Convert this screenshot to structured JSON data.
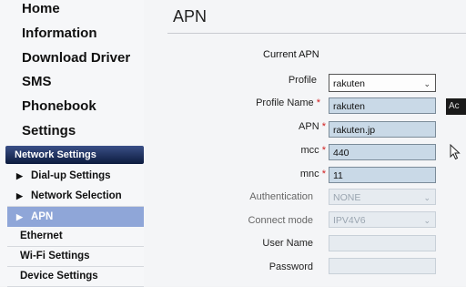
{
  "sidebar": {
    "items": [
      {
        "label": "Home"
      },
      {
        "label": "Information"
      },
      {
        "label": "Download Driver"
      },
      {
        "label": "SMS"
      },
      {
        "label": "Phonebook"
      },
      {
        "label": "Settings"
      }
    ],
    "network_settings": {
      "header": "Network Settings",
      "sub_items": [
        {
          "label": "Dial-up Settings"
        },
        {
          "label": "Network Selection"
        },
        {
          "label": "APN",
          "active": true
        }
      ]
    },
    "other_items": [
      {
        "label": "Ethernet"
      },
      {
        "label": "Wi-Fi Settings"
      },
      {
        "label": "Device Settings"
      }
    ]
  },
  "main": {
    "title": "APN",
    "current_apn_label": "Current APN",
    "fields": {
      "profile": {
        "label": "Profile",
        "value": "rakuten"
      },
      "profile_name": {
        "label": "Profile Name",
        "value": "rakuten",
        "required": "*"
      },
      "apn": {
        "label": "APN",
        "value": "rakuten.jp",
        "required": "*"
      },
      "mcc": {
        "label": "mcc",
        "value": "440",
        "required": "*"
      },
      "mnc": {
        "label": "mnc",
        "value": "11",
        "required": "*"
      },
      "authentication": {
        "label": "Authentication",
        "value": "NONE"
      },
      "connect_mode": {
        "label": "Connect mode",
        "value": "IPV4V6"
      },
      "user_name": {
        "label": "User Name",
        "value": ""
      },
      "password": {
        "label": "Password",
        "value": ""
      }
    },
    "add_button": "Ac"
  },
  "colors": {
    "accent_header": "#1c2d5c",
    "active_item": "#8fa6d8",
    "field_bg": "#c9d9e7",
    "required_star": "#d02020"
  }
}
